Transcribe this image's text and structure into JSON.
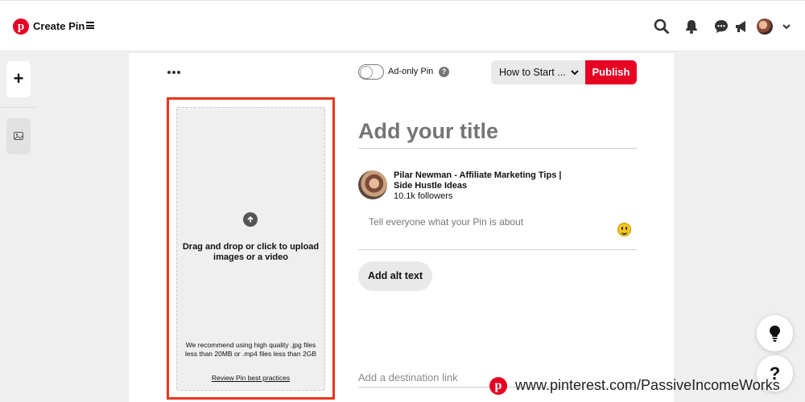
{
  "header": {
    "app_title": "Create Pin",
    "icons": [
      "pinterest-logo",
      "menu-icon",
      "search-icon",
      "bell-icon",
      "chat-icon",
      "megaphone-icon",
      "avatar",
      "chevron-down-icon"
    ]
  },
  "rail": {
    "icons": [
      "plus-icon",
      "image-icon"
    ]
  },
  "toolbar": {
    "ad_only_label": "Ad-only Pin",
    "ad_only_on": false,
    "board_selected": "How to Start ...",
    "publish_label": "Publish"
  },
  "upload": {
    "main_text": "Drag and drop or click to upload images or a video",
    "hint_text": "We recommend using high quality .jpg files less than 20MB or .mp4 files less than 2GB",
    "link_text": "Review Pin best practices"
  },
  "form": {
    "title_placeholder": "Add your title",
    "author_name": "Pilar Newman - Affiliate Marketing Tips | Side Hustle Ideas",
    "author_followers": "10.1k followers",
    "description_placeholder": "Tell everyone what your Pin is about",
    "alt_text_button": "Add alt text",
    "destination_placeholder": "Add a destination link"
  },
  "floating": {
    "help_label": "?"
  },
  "watermark": {
    "text": "www.pinterest.com/PassiveIncomeWorks"
  },
  "colors": {
    "brand_red": "#e60023",
    "highlight_border": "#e8361b"
  }
}
